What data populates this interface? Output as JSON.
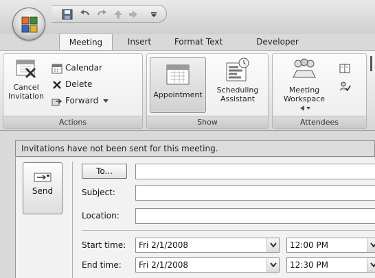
{
  "quick_access": {
    "icons": [
      "save-icon",
      "undo-icon",
      "redo-icon",
      "previous-item-icon",
      "next-item-icon",
      "customize-icon"
    ]
  },
  "tabs": [
    {
      "label": "Meeting",
      "active": true
    },
    {
      "label": "Insert",
      "active": false
    },
    {
      "label": "Format Text",
      "active": false
    },
    {
      "label": "Developer",
      "active": false
    }
  ],
  "ribbon": {
    "actions": {
      "label": "Actions",
      "cancel_line1": "Cancel",
      "cancel_line2": "Invitation",
      "calendar": "Calendar",
      "delete": "Delete",
      "forward": "Forward"
    },
    "show": {
      "label": "Show",
      "appointment": "Appointment",
      "scheduling_line1": "Scheduling",
      "scheduling_line2": "Assistant"
    },
    "attendees": {
      "label": "Attendees",
      "workspace_line1": "Meeting",
      "workspace_line2": "Workspace"
    }
  },
  "infobar": {
    "text": "Invitations have not been sent for this meeting."
  },
  "form": {
    "send": "Send",
    "to": "To...",
    "subject_label": "Subject:",
    "location_label": "Location:",
    "start_label": "Start time:",
    "end_label": "End time:",
    "start_date": "Fri 2/1/2008",
    "start_time": "12:00 PM",
    "end_date": "Fri 2/1/2008",
    "end_time": "12:30 PM",
    "subject_value": "",
    "location_value": ""
  }
}
